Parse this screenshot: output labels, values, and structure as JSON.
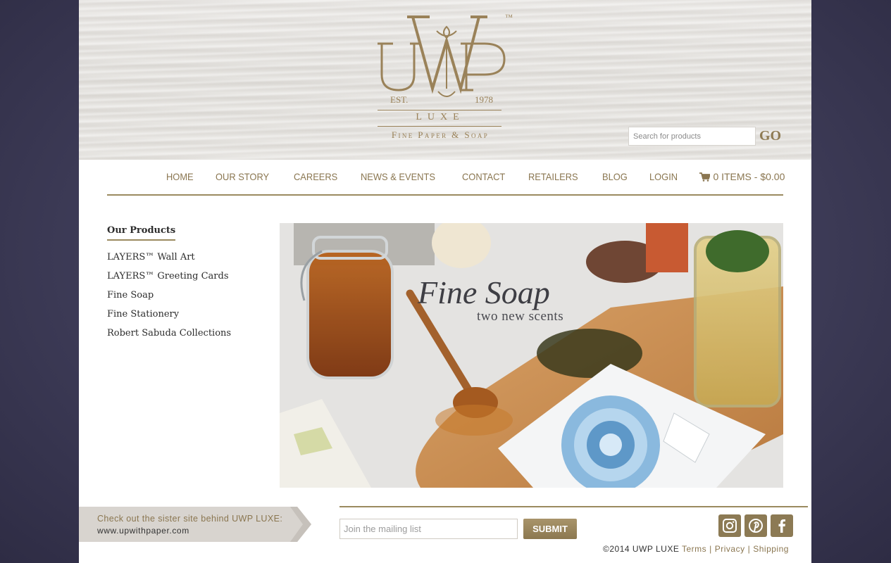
{
  "header": {
    "logo": {
      "monogram": "UWP",
      "tm": "™",
      "est_left": "EST.",
      "est_right": "1978",
      "luxe": "LUXE",
      "tagline": "Fine Paper & Soap"
    },
    "search": {
      "placeholder": "Search for products",
      "go_label": "GO"
    }
  },
  "nav": {
    "items": [
      {
        "label": "HOME"
      },
      {
        "label": "OUR STORY"
      },
      {
        "label": "CAREERS"
      },
      {
        "label": "NEWS & EVENTS"
      },
      {
        "label": "CONTACT"
      },
      {
        "label": "RETAILERS"
      },
      {
        "label": "BLOG"
      },
      {
        "label": "LOGIN"
      }
    ],
    "cart": {
      "icon": "cart-icon",
      "label": "0 ITEMS - $0.00"
    }
  },
  "sidebar": {
    "title": "Our Products",
    "items": [
      {
        "label": "LAYERS™  Wall Art"
      },
      {
        "label": "LAYERS™  Greeting Cards"
      },
      {
        "label": "Fine Soap"
      },
      {
        "label": "Fine Stationery"
      },
      {
        "label": "Robert Sabuda Collections"
      }
    ]
  },
  "hero": {
    "title": "Fine Soap",
    "subtitle": "two new scents"
  },
  "footer": {
    "sister": {
      "line1": "Check out the sister site behind UWP LUXE:",
      "line2": "www.upwithpaper.com"
    },
    "mailing": {
      "placeholder": "Join the mailing list",
      "submit_label": "SUBMIT"
    },
    "social": [
      {
        "icon": "instagram-icon"
      },
      {
        "icon": "pinterest-icon"
      },
      {
        "icon": "facebook-icon"
      }
    ],
    "copyright": "©2014 UWP LUXE",
    "links": {
      "terms": "Terms",
      "privacy": "Privacy",
      "shipping": "Shipping"
    },
    "separator": "|"
  },
  "colors": {
    "gold": "#8a7650",
    "background": "#3e3c58"
  }
}
